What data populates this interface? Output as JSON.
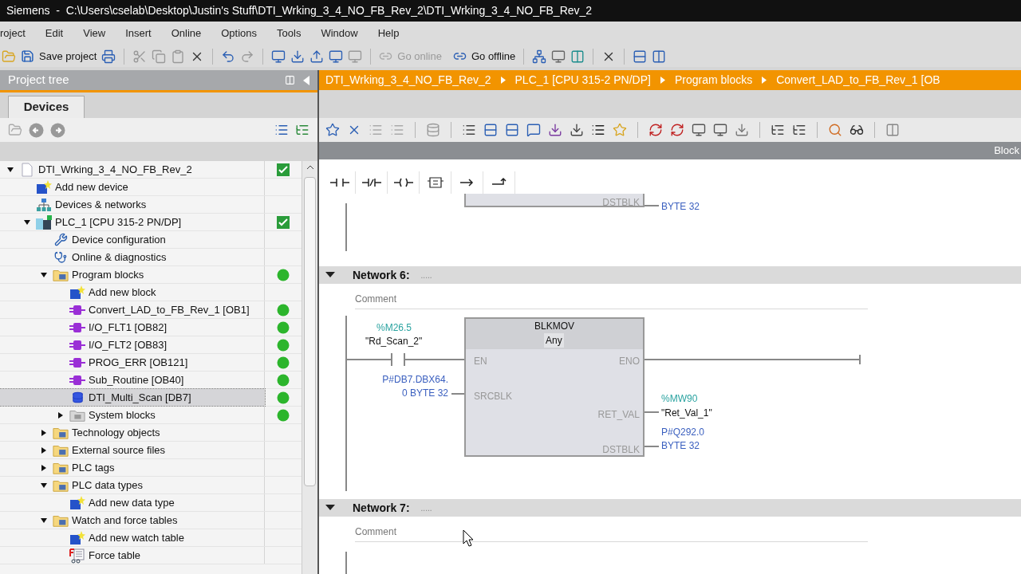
{
  "window": {
    "title": "Siemens  -  C:\\Users\\cselab\\Desktop\\Justin's Stuff\\DTI_Wrking_3_4_NO_FB_Rev_2\\DTI_Wrking_3_4_NO_FB_Rev_2"
  },
  "menu": [
    "roject",
    "Edit",
    "View",
    "Insert",
    "Online",
    "Options",
    "Tools",
    "Window",
    "Help"
  ],
  "toolbar": {
    "save": {
      "label": "Save project"
    },
    "go_online": {
      "label": "Go online",
      "disabled": true
    },
    "go_offline": {
      "label": "Go offline",
      "disabled": false
    }
  },
  "project_tree": {
    "title": "Project tree",
    "tab": "Devices",
    "items": [
      {
        "label": "DTI_Wrking_3_4_NO_FB_Rev_2",
        "kind": "project",
        "status": {
          "kind": "check"
        },
        "expanded": true,
        "selected": false,
        "children": [
          {
            "label": "Add new device",
            "kind": "add",
            "selected": false
          },
          {
            "label": "Devices & networks",
            "kind": "network",
            "selected": false
          },
          {
            "label": "PLC_1 [CPU 315-2 PN/DP]",
            "kind": "plc",
            "status": {
              "kind": "check"
            },
            "expanded": true,
            "selected": false,
            "children": [
              {
                "label": "Device configuration",
                "kind": "config",
                "selected": false
              },
              {
                "label": "Online & diagnostics",
                "kind": "diag",
                "selected": false
              },
              {
                "label": "Program blocks",
                "kind": "folder",
                "status": {
                  "kind": "ok"
                },
                "expanded": true,
                "selected": false,
                "children": [
                  {
                    "label": "Add new block",
                    "kind": "add",
                    "selected": false
                  },
                  {
                    "label": "Convert_LAD_to_FB_Rev_1 [OB1]",
                    "kind": "ob",
                    "status": {
                      "kind": "ok"
                    },
                    "selected": false
                  },
                  {
                    "label": "I/O_FLT1 [OB82]",
                    "kind": "ob",
                    "status": {
                      "kind": "ok"
                    },
                    "selected": false
                  },
                  {
                    "label": "I/O_FLT2 [OB83]",
                    "kind": "ob",
                    "status": {
                      "kind": "ok"
                    },
                    "selected": false
                  },
                  {
                    "label": "PROG_ERR [OB121]",
                    "kind": "ob",
                    "status": {
                      "kind": "ok"
                    },
                    "selected": false
                  },
                  {
                    "label": "Sub_Routine [OB40]",
                    "kind": "ob",
                    "status": {
                      "kind": "ok"
                    },
                    "selected": false
                  },
                  {
                    "label": "DTI_Multi_Scan [DB7]",
                    "kind": "db",
                    "status": {
                      "kind": "ok"
                    },
                    "selected": true
                  },
                  {
                    "label": "System blocks",
                    "kind": "sysfolder",
                    "status": {
                      "kind": "ok"
                    },
                    "expanded": false,
                    "selected": false
                  }
                ]
              },
              {
                "label": "Technology objects",
                "kind": "folder",
                "expanded": false,
                "selected": false
              },
              {
                "label": "External source files",
                "kind": "folder",
                "expanded": false,
                "selected": false
              },
              {
                "label": "PLC tags",
                "kind": "folder",
                "expanded": false,
                "selected": false
              },
              {
                "label": "PLC data types",
                "kind": "folder",
                "expanded": true,
                "selected": false,
                "children": [
                  {
                    "label": "Add new data type",
                    "kind": "add",
                    "selected": false
                  }
                ]
              },
              {
                "label": "Watch and force tables",
                "kind": "folder",
                "expanded": true,
                "selected": false,
                "children": [
                  {
                    "label": "Add new watch table",
                    "kind": "add",
                    "selected": false
                  },
                  {
                    "label": "Force table",
                    "kind": "force",
                    "selected": false
                  }
                ]
              }
            ]
          }
        ]
      }
    ]
  },
  "editor": {
    "breadcrumb": [
      "DTI_Wrking_3_4_NO_FB_Rev_2",
      "PLC_1 [CPU 315-2 PN/DP]",
      "Program blocks",
      "Convert_LAD_to_FB_Rev_1 [OB"
    ],
    "side_label": "Block",
    "networks": [
      {
        "kind": "partial",
        "param": "DSTBLK",
        "value": "BYTE 32"
      },
      {
        "kind": "full",
        "title": "Network 6:",
        "dots": ".....",
        "comment": "Comment",
        "expanded": true,
        "contact": {
          "address": "%M26.5",
          "tag": "\"Rd_Scan_2\""
        },
        "block": {
          "name": "BLKMOV",
          "type": "Any",
          "en": "EN",
          "eno": "ENO",
          "srcblk": {
            "param": "SRCBLK",
            "lines": [
              "P#DB7.DBX64.",
              "0 BYTE 32"
            ]
          },
          "ret_val": {
            "param": "RET_VAL",
            "address": "%MW90",
            "tag": "\"Ret_Val_1\""
          },
          "dstblk": {
            "param": "DSTBLK",
            "lines": [
              "P#Q292.0",
              "BYTE 32"
            ]
          }
        }
      },
      {
        "kind": "header",
        "title": "Network 7:",
        "dots": ".....",
        "comment": "Comment",
        "expanded": true
      }
    ]
  }
}
